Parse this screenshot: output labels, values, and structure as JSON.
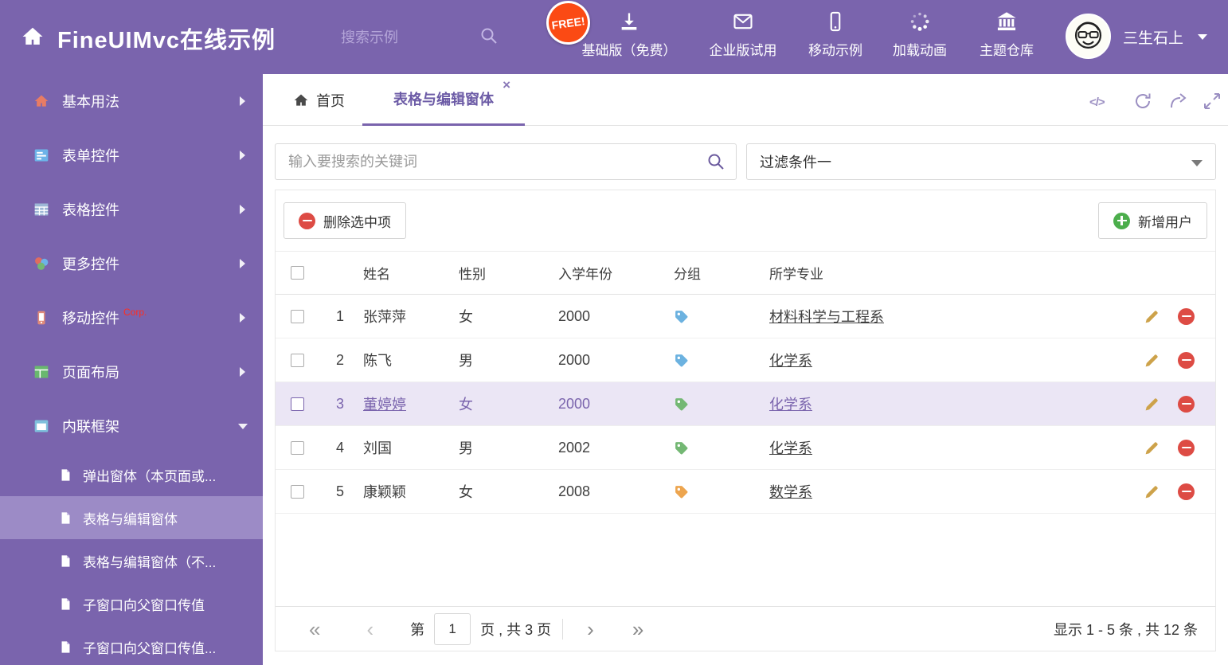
{
  "colors": {
    "theme_purple": "#7a64ad",
    "sidebar_active_bg": "#9c8bc6",
    "free_badge_bg": "#fb4a14",
    "delete_red": "#dd4b44",
    "add_green": "#4cae4c",
    "pencil_gold": "#cda24a",
    "selected_row_bg": "#ebe6f5"
  },
  "header": {
    "app_title": "FineUIMvc在线示例",
    "search_placeholder": "搜索示例",
    "free_badge": "FREE!",
    "nav": [
      {
        "label": "基础版（免费）",
        "icon": "download-icon"
      },
      {
        "label": "企业版试用",
        "icon": "envelope-icon"
      },
      {
        "label": "移动示例",
        "icon": "mobile-icon"
      },
      {
        "label": "加载动画",
        "icon": "spinner-icon"
      },
      {
        "label": "主题仓库",
        "icon": "theme-store-icon"
      }
    ],
    "username": "三生石上"
  },
  "sidebar": {
    "items": [
      {
        "label": "基本用法"
      },
      {
        "label": "表单控件"
      },
      {
        "label": "表格控件"
      },
      {
        "label": "更多控件"
      },
      {
        "label": "移动控件",
        "badge": "Corp."
      },
      {
        "label": "页面布局"
      },
      {
        "label": "内联框架",
        "expanded": true
      }
    ],
    "subitems": [
      {
        "label": "弹出窗体（本页面或..."
      },
      {
        "label": "表格与编辑窗体",
        "active": true
      },
      {
        "label": "表格与编辑窗体（不..."
      },
      {
        "label": "子窗口向父窗口传值"
      },
      {
        "label": "子窗口向父窗口传值..."
      }
    ]
  },
  "tabbar": {
    "home_tab": "首页",
    "active_tab": "表格与编辑窗体",
    "close_icon": "×",
    "code_icon": "</>"
  },
  "filterbar": {
    "search_placeholder": "输入要搜索的关键词",
    "filter_value": "过滤条件一"
  },
  "grid": {
    "delete_button": "删除选中项",
    "add_button": "新增用户",
    "columns": [
      "姓名",
      "性别",
      "入学年份",
      "分组",
      "所学专业"
    ],
    "rows": [
      {
        "num": "1",
        "name": "张萍萍",
        "gender": "女",
        "year": "2000",
        "tag_color": "#6cb2e0",
        "major": "材料科学与工程系",
        "selected": false
      },
      {
        "num": "2",
        "name": "陈飞",
        "gender": "男",
        "year": "2000",
        "tag_color": "#6cb2e0",
        "major": "化学系",
        "selected": false
      },
      {
        "num": "3",
        "name": "董婷婷",
        "gender": "女",
        "year": "2000",
        "tag_color": "#74b874",
        "major": "化学系",
        "selected": true
      },
      {
        "num": "4",
        "name": "刘国",
        "gender": "男",
        "year": "2002",
        "tag_color": "#74b874",
        "major": "化学系",
        "selected": false
      },
      {
        "num": "5",
        "name": "康颖颖",
        "gender": "女",
        "year": "2008",
        "tag_color": "#eda54f",
        "major": "数学系",
        "selected": false
      }
    ]
  },
  "pagination": {
    "first_icon": "«",
    "prev_icon": "‹",
    "next_icon": "›",
    "last_icon": "»",
    "page_prefix": "第",
    "page_value": "1",
    "page_suffix": "页 , 共 3 页",
    "summary": "显示 1 - 5 条 , 共 12 条"
  }
}
